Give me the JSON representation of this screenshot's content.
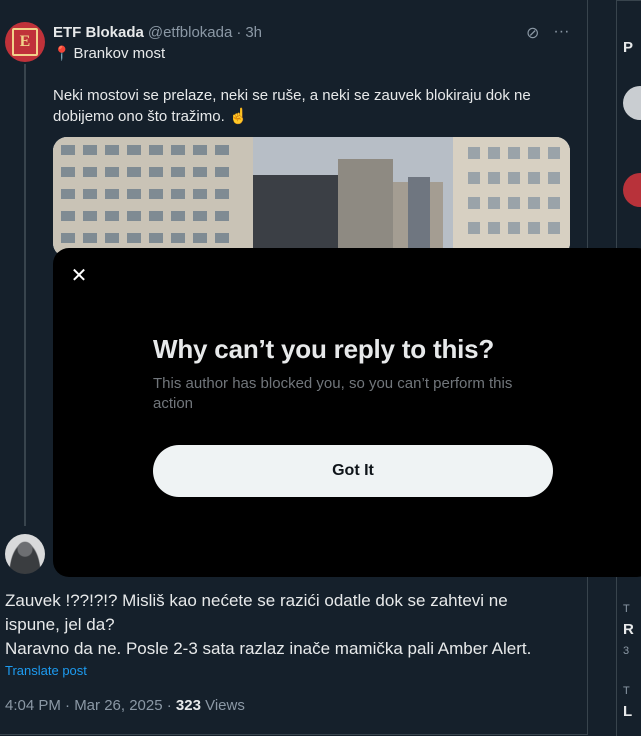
{
  "tweet": {
    "author_name": "ETF Blokada",
    "handle": "@etfblokada",
    "separator": "·",
    "time_ago": "3h",
    "location": "Brankov most",
    "text": "Neki mostovi se prelaze, neki se ruše, a neki se zauvek blokiraju dok ne dobijemo ono što tražimo.",
    "emoji": "☝"
  },
  "modal": {
    "title": "Why can’t you reply to this?",
    "subtitle": "This author has blocked you, so you can’t perform this action",
    "button_label": "Got It"
  },
  "reply": {
    "line1": "Zauvek !??!?!? Misliš kao nećete se razići odatle dok se zahtevi ne ispune, jel da?",
    "line2": "Naravno da ne. Posle 2-3 sata razlaz inače mamička pali Amber Alert.",
    "translate_label": "Translate post",
    "time": "4:04 PM · Mar 26, 2025 · ",
    "views_count": "323",
    "views_label": " Views"
  },
  "right_sidebar": {
    "frag1": "P",
    "frag2": "T",
    "frag3": "R",
    "frag4": "3",
    "frag5": "T",
    "frag6": "L"
  },
  "colors": {
    "background": "#15202b",
    "modal_bg": "#000000",
    "button_bg": "#eff3f4",
    "link": "#1d9bf0",
    "muted": "#8b98a5"
  },
  "icons": [
    "grok-icon",
    "more-icon",
    "pin-icon",
    "close-icon"
  ]
}
